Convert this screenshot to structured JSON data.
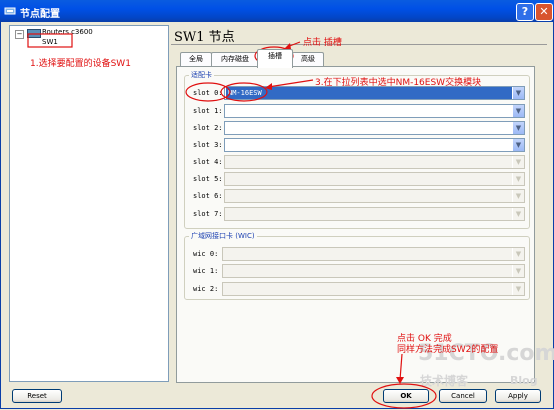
{
  "window": {
    "title": "节点配置",
    "help_label": "?",
    "close_label": "✕"
  },
  "tree": {
    "root_label": "Routers c3600",
    "child_label": "SW1",
    "expander": "−"
  },
  "header": {
    "title": "SW1 节点"
  },
  "tabs": [
    {
      "label": "全局",
      "active": false
    },
    {
      "label": "内存磁盘",
      "active": false
    },
    {
      "label": "插槽",
      "active": true
    },
    {
      "label": "高级",
      "active": false
    }
  ],
  "slots_group": {
    "title": "适配卡",
    "slots": [
      {
        "label": "slot 0:",
        "value": "NM-16ESW",
        "enabled": true
      },
      {
        "label": "slot 1:",
        "value": "",
        "enabled": true
      },
      {
        "label": "slot 2:",
        "value": "",
        "enabled": true
      },
      {
        "label": "slot 3:",
        "value": "",
        "enabled": true
      },
      {
        "label": "slot 4:",
        "value": "",
        "enabled": false
      },
      {
        "label": "slot 5:",
        "value": "",
        "enabled": false
      },
      {
        "label": "slot 6:",
        "value": "",
        "enabled": false
      },
      {
        "label": "slot 7:",
        "value": "",
        "enabled": false
      }
    ]
  },
  "wic_group": {
    "title": "广域网接口卡 (WIC)",
    "slots": [
      {
        "label": "wic 0:",
        "value": "",
        "enabled": false
      },
      {
        "label": "wic 1:",
        "value": "",
        "enabled": false
      },
      {
        "label": "wic 2:",
        "value": "",
        "enabled": false
      }
    ]
  },
  "buttons": {
    "reset": "Reset",
    "ok": "OK",
    "cancel": "Cancel",
    "apply": "Apply"
  },
  "annotations": {
    "step1": "1.选择要配置的设备SW1",
    "click_slot": "点击  插槽",
    "step3": "3.在下拉列表中选中NM-16ESW交换模块",
    "finish_line1": "点击 OK 完成",
    "finish_line2": "同样方法完成SW2的配置"
  },
  "watermark": {
    "line1": "51CTO.com",
    "line2": "技术博客",
    "line3": "Blog"
  },
  "colors": {
    "annotation": "#e01010",
    "titlebar": "#0050e6",
    "selection": "#316ac5"
  }
}
